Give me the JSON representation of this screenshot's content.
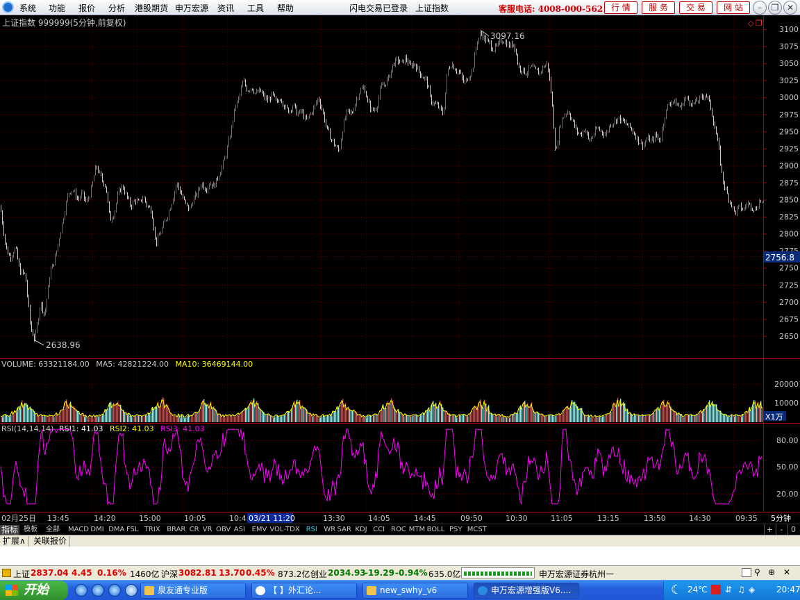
{
  "menu": {
    "items": [
      "系统",
      "功能",
      "报价",
      "分析",
      "港股期货",
      "申万宏源",
      "资讯",
      "工具",
      "帮助"
    ],
    "notices": [
      "闪电交易已登录",
      "上证指数"
    ],
    "hotline": "客服电话: 4008-000-562",
    "tabs": [
      "行 情",
      "服 务",
      "交 易",
      "网 站"
    ]
  },
  "main": {
    "title": "上证指数 999999(5分钟,前复权)",
    "price_axis": [
      "3100",
      "3075",
      "3050",
      "3025",
      "3000",
      "2975",
      "2950",
      "2925",
      "2900",
      "2875",
      "2850",
      "2825",
      "2800",
      "2775",
      "2750",
      "2725",
      "2700",
      "2675",
      "2650"
    ],
    "high_label": "3097.16",
    "low_label": "2638.96",
    "current_price_tag": "2756.8"
  },
  "volume": {
    "header_prefix": "VOLUME: 63321184.00",
    "ma5": "MA5: 42821224.00",
    "ma10": "MA10: 36469144.00",
    "axis": [
      "20000",
      "10000"
    ],
    "unit": "X1万"
  },
  "rsi": {
    "header_prefix": "RSI(14,14,14)",
    "rsi1": "RSI1: 41.03",
    "rsi2": "RSI2: 41.03",
    "rsi3": "RSI3: 41.03",
    "axis": [
      "80.00",
      "50.00",
      "20.00"
    ]
  },
  "time_axis": {
    "labels": [
      "02月25日",
      "13:45",
      "14:20",
      "15:00",
      "10:05",
      "10:4",
      "13:30",
      "14:05",
      "14:45",
      "09:50",
      "10:30",
      "11:05",
      "13:15",
      "13:50",
      "14:30",
      "09:35"
    ],
    "cursor_label": "03/21 11:20",
    "period": "5分钟"
  },
  "indicator_tabs": {
    "items": [
      "指标",
      "模板",
      "全部",
      "MACD",
      "DMI",
      "DMA",
      "FSL",
      "TRIX",
      "BRAR",
      "CR",
      "VR",
      "OBV",
      "ASI",
      "EMV",
      "VOL-TDX",
      "RSI",
      "WR",
      "SAR",
      "KDJ",
      "CCI",
      "ROC",
      "MTM",
      "BOLL",
      "PSY",
      "MCST"
    ],
    "active": "RSI",
    "controls": [
      "+",
      "-",
      "0"
    ]
  },
  "ext_tabs": [
    "扩展∧",
    "关联报价"
  ],
  "status": {
    "sh_name": "上证",
    "sh_price": "2837.04",
    "sh_change": "4.45",
    "sh_pct": "0.16%",
    "sh_amount": "1460亿",
    "hs_name": "沪深",
    "hs_price": "3082.81",
    "hs_change": "13.70",
    "hs_pct": "0.45%",
    "hs_amount": "873.2亿",
    "cy_name": "创业",
    "cy_price": "2034.93",
    "cy_change": "-19.29",
    "cy_pct": "-0.94%",
    "cy_amount": "635.0亿",
    "broker": "申万宏源证券杭州一"
  },
  "taskbar": {
    "start": "开始",
    "tasks": [
      "泉友通专业版",
      "【         】外汇论...",
      "new_swhy_v6",
      "申万宏源增强版V6...."
    ],
    "temperature": "24℃",
    "clock": "20:47"
  },
  "colors": {
    "up": "#ff3232",
    "down": "#54fcfc",
    "ma5": "#ffff00",
    "ma10": "#ff00ff",
    "rsi": "#ff00ff",
    "grid": "#7a0000",
    "frame": "#b00000"
  },
  "chart_data": {
    "type": "candlestick",
    "title": "上证指数 999999(5分钟,前复权)",
    "ylim": [
      2630,
      3110
    ],
    "high": 3097.16,
    "low": 2638.96,
    "current_price": 2756.8,
    "points": [
      [
        0,
        2840
      ],
      [
        8,
        2780
      ],
      [
        14,
        2765
      ],
      [
        22,
        2780
      ],
      [
        28,
        2745
      ],
      [
        36,
        2740
      ],
      [
        44,
        2660
      ],
      [
        50,
        2645
      ],
      [
        58,
        2700
      ],
      [
        64,
        2680
      ],
      [
        72,
        2745
      ],
      [
        78,
        2760
      ],
      [
        86,
        2800
      ],
      [
        92,
        2830
      ],
      [
        98,
        2860
      ],
      [
        104,
        2865
      ],
      [
        112,
        2850
      ],
      [
        118,
        2860
      ],
      [
        124,
        2845
      ],
      [
        130,
        2860
      ],
      [
        138,
        2900
      ],
      [
        146,
        2880
      ],
      [
        152,
        2870
      ],
      [
        158,
        2820
      ],
      [
        164,
        2830
      ],
      [
        170,
        2860
      ],
      [
        176,
        2870
      ],
      [
        182,
        2855
      ],
      [
        188,
        2840
      ],
      [
        194,
        2850
      ],
      [
        200,
        2845
      ],
      [
        206,
        2855
      ],
      [
        212,
        2840
      ],
      [
        218,
        2835
      ],
      [
        224,
        2785
      ],
      [
        230,
        2800
      ],
      [
        236,
        2815
      ],
      [
        242,
        2830
      ],
      [
        248,
        2850
      ],
      [
        254,
        2875
      ],
      [
        260,
        2860
      ],
      [
        266,
        2845
      ],
      [
        272,
        2835
      ],
      [
        278,
        2850
      ],
      [
        284,
        2860
      ],
      [
        290,
        2875
      ],
      [
        296,
        2865
      ],
      [
        302,
        2875
      ],
      [
        308,
        2870
      ],
      [
        314,
        2885
      ],
      [
        320,
        2900
      ],
      [
        326,
        2920
      ],
      [
        332,
        2950
      ],
      [
        338,
        2985
      ],
      [
        344,
        3000
      ],
      [
        350,
        3025
      ],
      [
        356,
        3010
      ],
      [
        362,
        3015
      ],
      [
        368,
        3005
      ],
      [
        374,
        3010
      ],
      [
        380,
        3000
      ],
      [
        386,
        2995
      ],
      [
        392,
        3005
      ],
      [
        398,
        2990
      ],
      [
        404,
        3000
      ],
      [
        410,
        2985
      ],
      [
        416,
        2980
      ],
      [
        422,
        2990
      ],
      [
        428,
        2975
      ],
      [
        434,
        2980
      ],
      [
        440,
        2965
      ],
      [
        446,
        2975
      ],
      [
        452,
        2985
      ],
      [
        458,
        3000
      ],
      [
        464,
        2980
      ],
      [
        470,
        2955
      ],
      [
        476,
        2940
      ],
      [
        482,
        2930
      ],
      [
        488,
        2920
      ],
      [
        494,
        2960
      ],
      [
        500,
        2980
      ],
      [
        506,
        2975
      ],
      [
        512,
        2995
      ],
      [
        518,
        3010
      ],
      [
        524,
        3015
      ],
      [
        530,
        2990
      ],
      [
        536,
        2980
      ],
      [
        542,
        2985
      ],
      [
        548,
        3015
      ],
      [
        554,
        3020
      ],
      [
        560,
        3030
      ],
      [
        566,
        3050
      ],
      [
        572,
        3055
      ],
      [
        578,
        3050
      ],
      [
        584,
        3058
      ],
      [
        590,
        3045
      ],
      [
        596,
        3050
      ],
      [
        602,
        3040
      ],
      [
        608,
        3030
      ],
      [
        614,
        3025
      ],
      [
        620,
        2995
      ],
      [
        626,
        2990
      ],
      [
        632,
        2985
      ],
      [
        638,
        2975
      ],
      [
        644,
        3040
      ],
      [
        650,
        3050
      ],
      [
        656,
        3040
      ],
      [
        662,
        3035
      ],
      [
        668,
        3020
      ],
      [
        674,
        3030
      ],
      [
        680,
        3040
      ],
      [
        686,
        3080
      ],
      [
        692,
        3095
      ],
      [
        698,
        3085
      ],
      [
        704,
        3080
      ],
      [
        710,
        3070
      ],
      [
        716,
        3075
      ],
      [
        722,
        3085
      ],
      [
        728,
        3080
      ],
      [
        734,
        3075
      ],
      [
        740,
        3080
      ],
      [
        746,
        3045
      ],
      [
        752,
        3040
      ],
      [
        758,
        3035
      ],
      [
        764,
        3045
      ],
      [
        770,
        3040
      ],
      [
        776,
        3035
      ],
      [
        782,
        3045
      ],
      [
        788,
        3050
      ],
      [
        794,
        3000
      ],
      [
        800,
        2915
      ],
      [
        806,
        2960
      ],
      [
        812,
        2975
      ],
      [
        818,
        2980
      ],
      [
        824,
        2965
      ],
      [
        830,
        2950
      ],
      [
        836,
        2945
      ],
      [
        842,
        2955
      ],
      [
        848,
        2935
      ],
      [
        854,
        2945
      ],
      [
        860,
        2955
      ],
      [
        866,
        2950
      ],
      [
        872,
        2945
      ],
      [
        878,
        2960
      ],
      [
        884,
        2965
      ],
      [
        890,
        2970
      ],
      [
        896,
        2965
      ],
      [
        902,
        2960
      ],
      [
        908,
        2955
      ],
      [
        914,
        2945
      ],
      [
        920,
        2935
      ],
      [
        926,
        2930
      ],
      [
        932,
        2940
      ],
      [
        938,
        2935
      ],
      [
        944,
        2945
      ],
      [
        950,
        2935
      ],
      [
        956,
        2970
      ],
      [
        962,
        2990
      ],
      [
        968,
        2995
      ],
      [
        974,
        2990
      ],
      [
        980,
        2985
      ],
      [
        986,
        3000
      ],
      [
        992,
        2995
      ],
      [
        998,
        2990
      ],
      [
        1004,
        2995
      ],
      [
        1010,
        3000
      ],
      [
        1016,
        3005
      ],
      [
        1022,
        2990
      ],
      [
        1028,
        2960
      ],
      [
        1034,
        2930
      ],
      [
        1040,
        2880
      ],
      [
        1046,
        2860
      ],
      [
        1052,
        2845
      ],
      [
        1058,
        2830
      ],
      [
        1064,
        2840
      ],
      [
        1070,
        2835
      ],
      [
        1076,
        2845
      ],
      [
        1082,
        2840
      ],
      [
        1088,
        2835
      ],
      [
        1094,
        2850
      ],
      [
        1100,
        2842
      ]
    ]
  }
}
